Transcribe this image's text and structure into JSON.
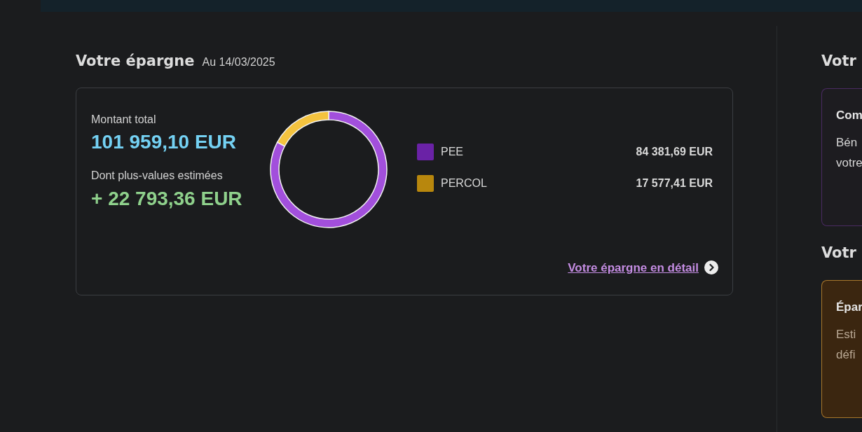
{
  "savings": {
    "title": "Votre épargne",
    "date": "Au 14/03/2025",
    "total": {
      "label": "Montant total",
      "value": "101 959,10 EUR"
    },
    "gains": {
      "label": "Dont plus-values estimées",
      "value": "+ 22 793,36 EUR"
    },
    "chart_data": {
      "type": "donut",
      "categories": [
        "PEE",
        "PERCOL"
      ],
      "values": [
        82.76,
        17.24
      ],
      "colors": [
        "#a24fdc",
        "#f4c33f"
      ]
    },
    "legend": [
      {
        "amount": "84 381,69 EUR",
        "color": "#6a22a6"
      },
      {
        "amount": "17 577,41 EUR",
        "color": "#b8870d"
      }
    ],
    "detail_link": "Votre épargne en détail"
  },
  "side_sections": [
    {
      "title": "Votr",
      "card": {
        "kind": "outline",
        "color": "#4a2a62",
        "title": "Com",
        "body_lines": [
          "Bén",
          "votre"
        ]
      }
    },
    {
      "title": "Votr",
      "card": {
        "kind": "filled",
        "color": "#a9772a",
        "title": "Épar",
        "body_lines": [
          "Esti",
          "défi"
        ]
      }
    }
  ]
}
